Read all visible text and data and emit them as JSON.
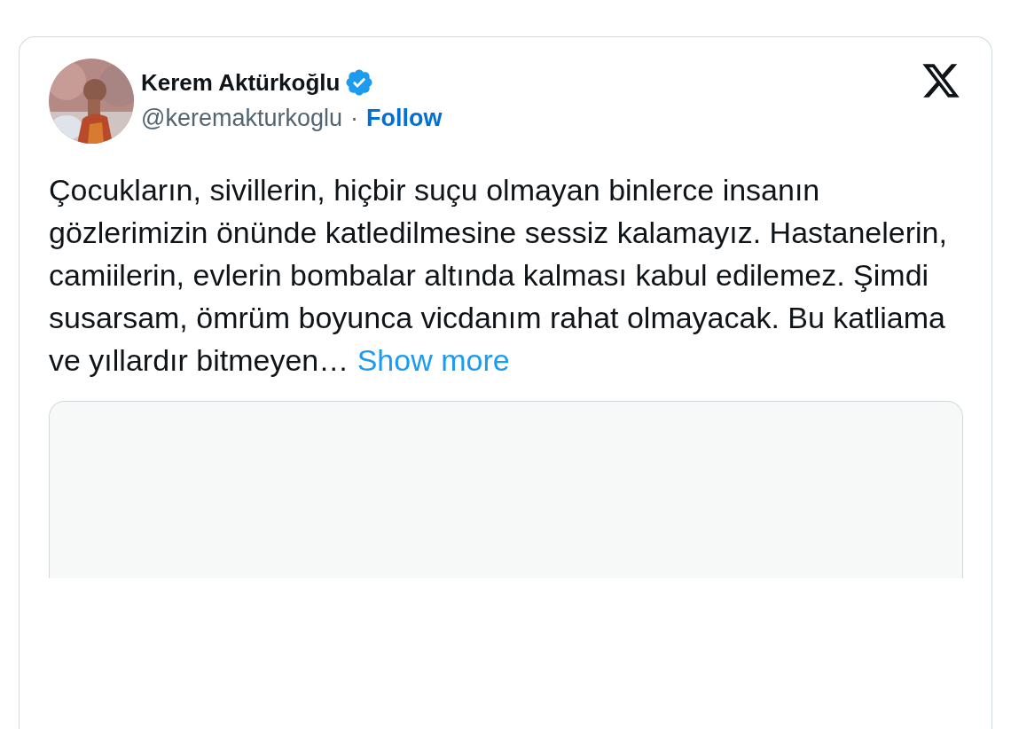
{
  "author": {
    "name": "Kerem Aktürkoğlu",
    "verified": true,
    "handle": "@keremakturkoglu",
    "separator": "·",
    "follow": "Follow"
  },
  "text": "Çocukların, sivillerin, hiçbir suçu olmayan binlerce insanın gözlerimizin önünde katledilmesine sessiz kalamayız. Hastanelerin, camiilerin, evlerin bombalar altında kalması kabul edilemez. Şimdi susarsam, ömrüm boyunca vicdanım rahat olmayacak. Bu katliama ve yıllardır bitmeyen…",
  "show_more": "Show more"
}
